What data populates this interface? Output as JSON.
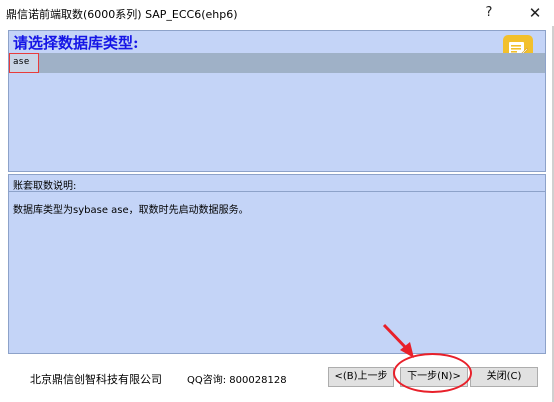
{
  "window": {
    "title": "鼎信诺前端取数(6000系列)   SAP_ECC6(ehp6)",
    "help_glyph": "?",
    "close_glyph": "✕"
  },
  "db_panel": {
    "heading": "请选择数据库类型:",
    "items": [
      "ase"
    ],
    "selected_index": 0,
    "icon": "memo-note-icon",
    "background_color": "#c4d4f7",
    "heading_color": "#1515e6"
  },
  "description_panel": {
    "header": "账套取数说明:",
    "text": "数据库类型为sybase ase，取数时先启动数据服务。"
  },
  "footer": {
    "company": "北京鼎信创智科技有限公司",
    "qq": "QQ咨询: 800028128",
    "prev_label": "<(B)上一步",
    "next_label": "下一步(N)>",
    "close_label": "关闭(C)"
  },
  "annotation": {
    "color": "#e8202a",
    "target": "next-button"
  }
}
